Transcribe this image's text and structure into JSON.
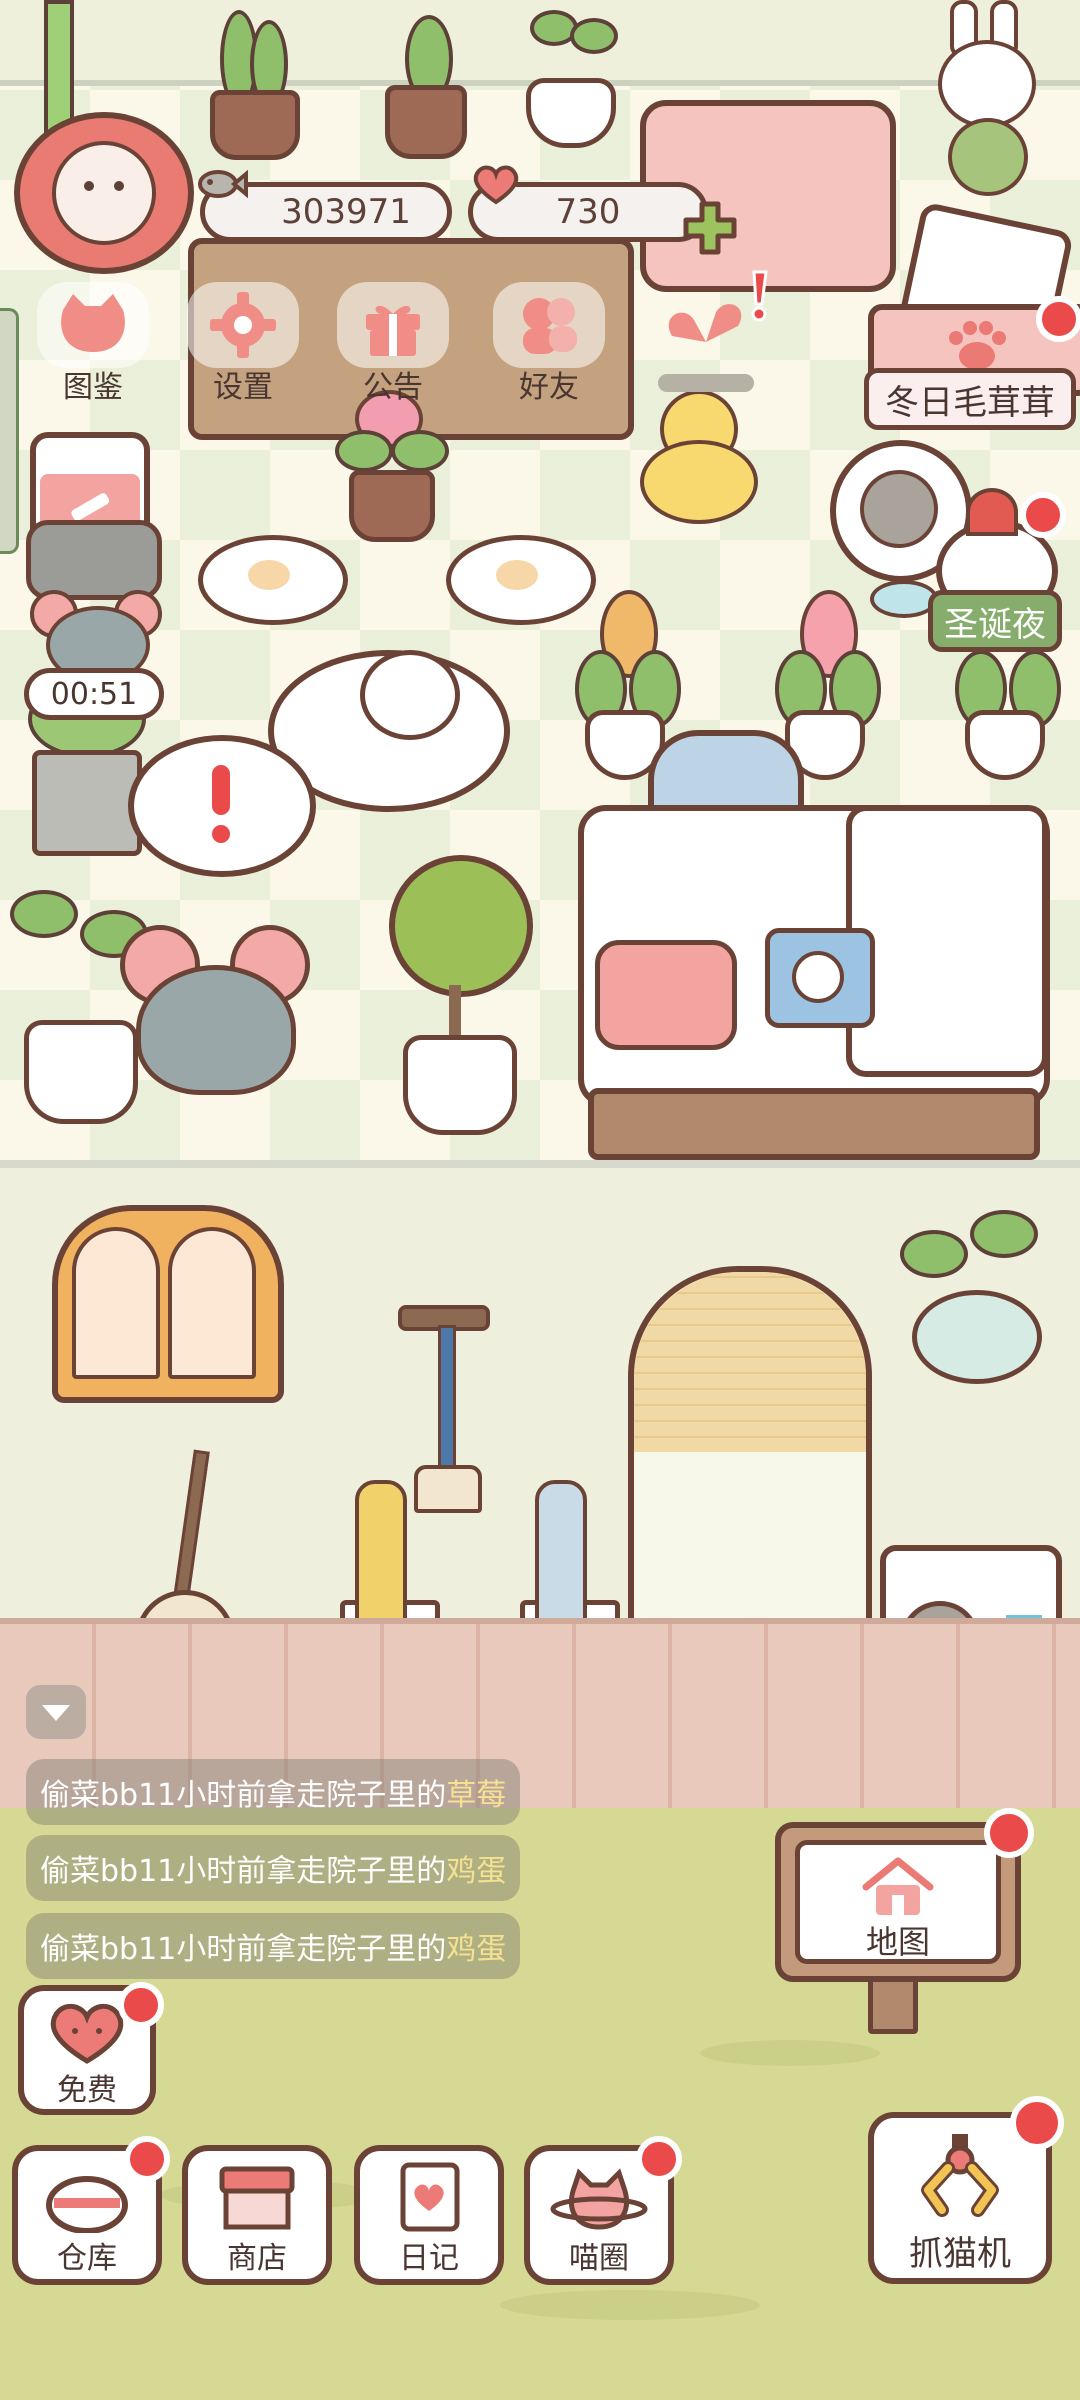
{
  "currency": {
    "fish_amount": "303971",
    "heart_amount": "730"
  },
  "top_menu": [
    {
      "label": "图鉴",
      "icon": "cat-head-icon"
    },
    {
      "label": "设置",
      "icon": "gear-icon"
    },
    {
      "label": "公告",
      "icon": "gift-icon"
    },
    {
      "label": "好友",
      "icon": "friends-icon"
    }
  ],
  "events": {
    "winter_event": "冬日毛茸茸",
    "christmas_event": "圣诞夜"
  },
  "timer": "00:51",
  "feed": [
    {
      "prefix": "偷菜bb11小时前拿走院子里的",
      "item": "草莓"
    },
    {
      "prefix": "偷菜bb11小时前拿走院子里的",
      "item": "鸡蛋"
    },
    {
      "prefix": "偷菜bb11小时前拿走院子里的",
      "item": "鸡蛋"
    }
  ],
  "map_label": "地图",
  "free_label": "免费",
  "dock": [
    {
      "label": "仓库",
      "icon": "warehouse-icon"
    },
    {
      "label": "商店",
      "icon": "shop-icon"
    },
    {
      "label": "日记",
      "icon": "diary-icon"
    },
    {
      "label": "喵圈",
      "icon": "cat-planet-icon"
    }
  ],
  "claw_machine_label": "抓猫机",
  "colors": {
    "badge_red": "#ea4a4a",
    "outline_brown": "#6b4336",
    "accent_pink": "#e97b73",
    "leaf_green": "#8fbf6b",
    "lawn_green": "#d6d993",
    "event_green": "#86ad6b",
    "feed_highlight": "#f7e190"
  }
}
